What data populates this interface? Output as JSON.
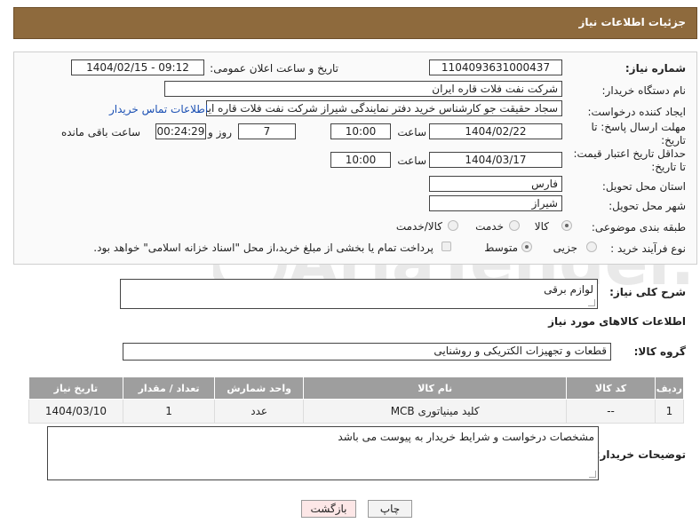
{
  "header": {
    "title": "جزئیات اطلاعات نیاز"
  },
  "form": {
    "need_number_label": "شماره نیاز:",
    "need_number": "1104093631000437",
    "announce_label": "تاریخ و ساعت اعلان عمومی:",
    "announce_value": "1404/02/15 - 09:12",
    "buyer_org_label": "نام دستگاه خریدار:",
    "buyer_org": "شرکت نفت فلات قاره ایران",
    "creator_label": "ایجاد کننده درخواست:",
    "creator": "سجاد حقیقت جو کارشناس خرید دفتر نمایندگی شیراز شرکت نفت فلات قاره ایر",
    "contact_link": "اطلاعات تماس خریدار",
    "reply_deadline_label": "مهلت ارسال پاسخ: تا تاریخ:",
    "reply_date": "1404/02/22",
    "time_label": "ساعت",
    "reply_time": "10:00",
    "days_value": "7",
    "days_label": "روز و",
    "remaining_value": "00:24:29",
    "remaining_label": "ساعت باقی مانده",
    "price_validity_label": "حداقل تاریخ اعتبار قیمت: تا تاریخ:",
    "price_date": "1404/03/17",
    "price_time": "10:00",
    "province_label": "استان محل تحویل:",
    "province": "فارس",
    "city_label": "شهر محل تحویل:",
    "city": "شیراز",
    "category_label": "طبقه بندی موضوعی:",
    "category_options": [
      "کالا",
      "خدمت",
      "کالا/خدمت"
    ],
    "process_label": "نوع فرآیند خرید :",
    "process_options": [
      "جزیی",
      "متوسط"
    ],
    "payment_note": "پرداخت تمام یا بخشی از مبلغ خرید،از محل \"اسناد خزانه اسلامی\" خواهد بود."
  },
  "summary": {
    "label": "شرح کلی نیاز:",
    "value": "لوازم برقی"
  },
  "goods_section_title": "اطلاعات کالاهای مورد نیاز",
  "goods_group": {
    "label": "گروه کالا:",
    "value": "قطعات و تجهیزات الکتریکی و روشنایی"
  },
  "table": {
    "headers": [
      "ردیف",
      "کد کالا",
      "نام کالا",
      "واحد شمارش",
      "تعداد / مقدار",
      "تاریخ نیاز"
    ],
    "rows": [
      [
        "1",
        "--",
        "کلید مینیاتوری MCB",
        "عدد",
        "1",
        "1404/03/10"
      ]
    ]
  },
  "buyer_notes": {
    "label": "توضیحات خریدار:",
    "value": "مشخصات درخواست و شرایط خریدار به پیوست می باشد"
  },
  "buttons": {
    "print": "چاپ",
    "back": "بازگشت"
  },
  "watermark": {
    "text": "AriaTender.neT"
  }
}
